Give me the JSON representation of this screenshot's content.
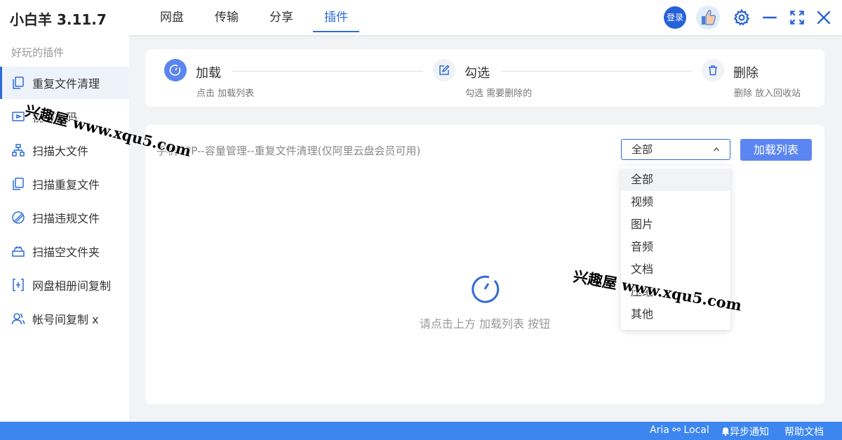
{
  "header": {
    "app_title": "小白羊 3.11.7",
    "tabs": [
      {
        "label": "网盘"
      },
      {
        "label": "传输"
      },
      {
        "label": "分享"
      },
      {
        "label": "插件"
      }
    ],
    "active_tab": "插件",
    "login_label": "登录"
  },
  "sidebar": {
    "heading": "好玩的插件",
    "items": [
      {
        "label": "重复文件清理",
        "icon": "copy-icon"
      },
      {
        "label": "视频转码",
        "icon": "video-icon"
      },
      {
        "label": "扫描大文件",
        "icon": "tree-icon"
      },
      {
        "label": "扫描重复文件",
        "icon": "copy-icon"
      },
      {
        "label": "扫描违规文件",
        "icon": "ban-icon"
      },
      {
        "label": "扫描空文件夹",
        "icon": "folder-icon"
      },
      {
        "label": "网盘相册间复制",
        "icon": "bracket-icon"
      },
      {
        "label": "帐号间复制 x",
        "icon": "users-icon"
      }
    ]
  },
  "steps": [
    {
      "title": "加载",
      "desc": "点击 加载列表"
    },
    {
      "title": "勾选",
      "desc": "勾选 需要删除的"
    },
    {
      "title": "删除",
      "desc": "删除 放入回收站"
    }
  ],
  "main": {
    "hint": "手机APP--容量管理--重复文件清理(仅阿里云盘会员可用)",
    "select_value": "全部",
    "load_button": "加载列表",
    "empty_text": "请点击上方 加载列表 按钮"
  },
  "dropdown": {
    "options": [
      "全部",
      "视频",
      "图片",
      "音频",
      "文档",
      "压缩",
      "其他"
    ],
    "selected": "全部"
  },
  "watermark": {
    "text1": "兴趣屋 www.xqu5.com",
    "text2": "兴趣屋 www.xqu5.com"
  },
  "statusbar": {
    "aria": "Aria ⚯ Local",
    "notify": "异步通知",
    "help": "帮助文档"
  },
  "colors": {
    "accent": "#2f6bd8",
    "button": "#5b86f2",
    "statusbar": "#3d86f0"
  }
}
